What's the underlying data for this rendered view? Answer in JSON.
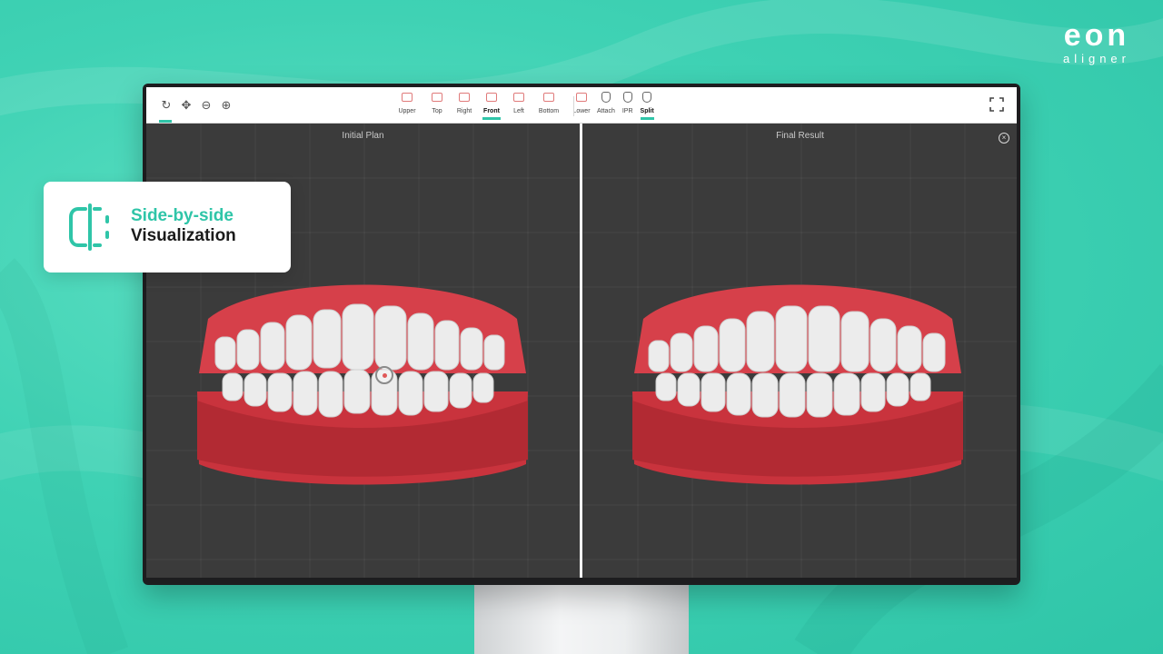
{
  "brand": {
    "name": "eon",
    "tagline": "aligner"
  },
  "feature_card": {
    "line1": "Side-by-side",
    "line2": "Visualization",
    "icon": "split-view-icon",
    "accent": "#2fc5a8"
  },
  "toolbar": {
    "left_tools": [
      {
        "name": "reset-icon",
        "glyph": "↻"
      },
      {
        "name": "pan-icon",
        "glyph": "✥"
      },
      {
        "name": "zoom-out-icon",
        "glyph": "⊖"
      },
      {
        "name": "zoom-in-icon",
        "glyph": "⊕"
      }
    ],
    "views": [
      "Upper",
      "Top",
      "Right",
      "Front",
      "Left",
      "Bottom",
      "Lower"
    ],
    "active_view": "Front",
    "modes": [
      "Attach",
      "IPR",
      "Split"
    ],
    "active_mode": "Split",
    "fullscreen_icon": "fullscreen-icon"
  },
  "panes": {
    "left_title": "Initial Plan",
    "right_title": "Final Result"
  },
  "colors": {
    "background": "#3fd2b4",
    "accent": "#2fc5a8",
    "viewport": "#3b3b3b",
    "gum": "#c9333d",
    "tooth": "#ececec"
  }
}
